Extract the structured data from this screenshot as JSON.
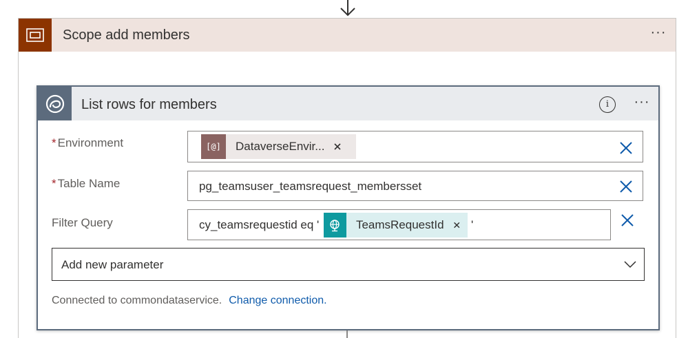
{
  "scope": {
    "title": "Scope add members",
    "icon": "scope-icon",
    "more": "···",
    "color": "#8c3400"
  },
  "card": {
    "title": "List rows for members",
    "icon": "dataverse-icon",
    "info": "i",
    "more": "···"
  },
  "fields": {
    "environment": {
      "label": "Environment",
      "required": "*",
      "token_label": "DataverseEnvir...",
      "token_icon": "[@]"
    },
    "table_name": {
      "label": "Table Name",
      "required": "*",
      "value": "pg_teamsuser_teamsrequest_membersset"
    },
    "filter_query": {
      "label": "Filter Query",
      "value_prefix": "cy_teamsrequestid eq '",
      "token_label": "TeamsRequestId",
      "token_icon": "globe-icon",
      "value_suffix": "'"
    }
  },
  "add_parameter": {
    "label": "Add new parameter"
  },
  "connection": {
    "text": "Connected to commondataservice.",
    "link": "Change connection."
  },
  "colors": {
    "env_token_icon": "#8a6361",
    "env_token_bg": "#ede8e7",
    "filter_token_icon": "#0e9a9f",
    "filter_token_bg": "#dbeff0",
    "clear_x": "#0f5bab"
  }
}
